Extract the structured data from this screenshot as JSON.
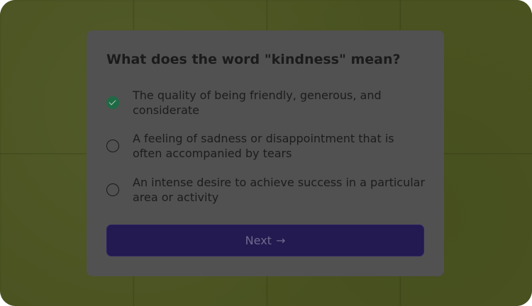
{
  "quiz": {
    "question": "What does the word \"kindness\" mean?",
    "options": [
      {
        "label": "The quality of being friendly, generous, and considerate",
        "selected": true
      },
      {
        "label": "A feeling of sadness or disappointment that is often accompanied by tears",
        "selected": false
      },
      {
        "label": "An intense desire to achieve success in a particular area or activity",
        "selected": false
      }
    ],
    "next_label": "Next",
    "next_arrow": "→"
  },
  "colors": {
    "background": "#4a5320",
    "card": "#515151",
    "selected_radio": "#1f6a45",
    "button": "#221a50"
  },
  "icons": {
    "selected": "check-circle-icon",
    "unselected": "empty-radio-icon",
    "next": "arrow-right-icon"
  }
}
